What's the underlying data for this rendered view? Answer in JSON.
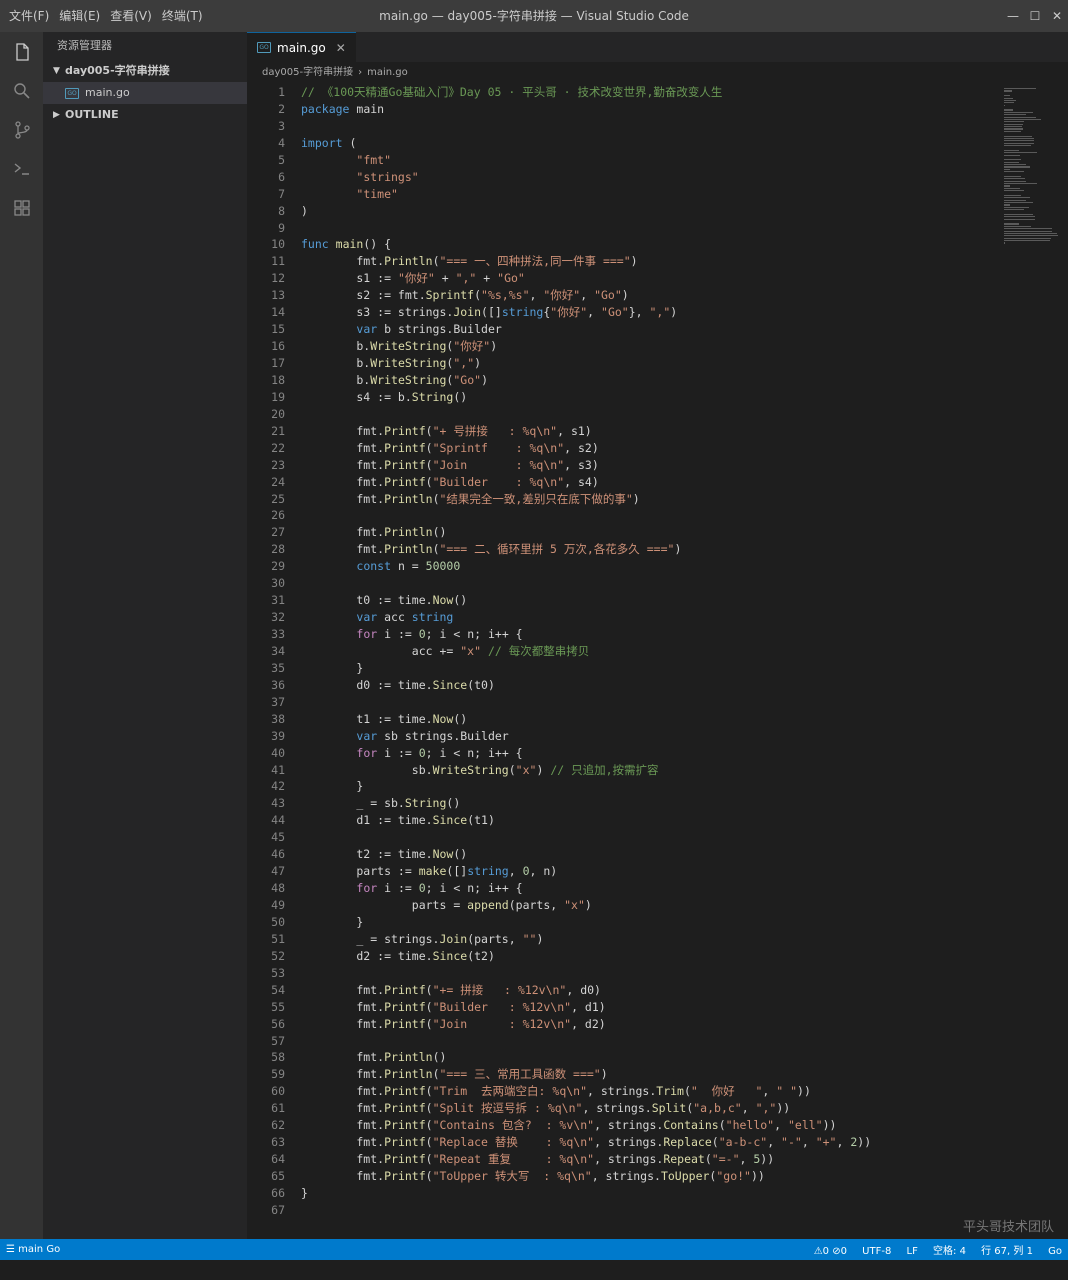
{
  "menu": [
    "文件(F)",
    "编辑(E)",
    "查看(V)",
    "终端(T)"
  ],
  "window_title": "main.go — day005-字符串拼接 — Visual Studio Code",
  "window_controls": {
    "minimize": "—",
    "maximize": "☐",
    "close": "✕"
  },
  "activity_icons": [
    "files-icon",
    "search-icon",
    "source-control-icon",
    "terminal-icon",
    "extensions-icon"
  ],
  "sidebar": {
    "title": "资源管理器",
    "folder": "day005-字符串拼接",
    "file": "main.go",
    "file_badge": "GO",
    "outline": "OUTLINE"
  },
  "tab": {
    "label": "main.go",
    "badge": "GO",
    "close": "✕"
  },
  "breadcrumb": [
    "day005-字符串拼接",
    "main.go"
  ],
  "code_lines": [
    [
      [
        "cm",
        "// 《100天精通Go基础入门》Day 05 · 平头哥 · 技术改变世界,勤奋改变人生"
      ]
    ],
    [
      [
        "kw",
        "package"
      ],
      [
        "pl",
        " main"
      ]
    ],
    [],
    [
      [
        "kw",
        "import"
      ],
      [
        "pl",
        " ("
      ]
    ],
    [
      [
        "pl",
        "        "
      ],
      [
        "str",
        "\"fmt\""
      ]
    ],
    [
      [
        "pl",
        "        "
      ],
      [
        "str",
        "\"strings\""
      ]
    ],
    [
      [
        "pl",
        "        "
      ],
      [
        "str",
        "\"time\""
      ]
    ],
    [
      [
        "pl",
        ")"
      ]
    ],
    [],
    [
      [
        "kw",
        "func"
      ],
      [
        "pl",
        " "
      ],
      [
        "fn",
        "main"
      ],
      [
        "pl",
        "() {"
      ]
    ],
    [
      [
        "pl",
        "        fmt."
      ],
      [
        "fn",
        "Println"
      ],
      [
        "pl",
        "("
      ],
      [
        "str",
        "\"=== 一、四种拼法,同一件事 ===\""
      ],
      [
        "pl",
        ")"
      ]
    ],
    [
      [
        "pl",
        "        s1 := "
      ],
      [
        "str",
        "\"你好\""
      ],
      [
        "pl",
        " + "
      ],
      [
        "str",
        "\",\""
      ],
      [
        "pl",
        " + "
      ],
      [
        "str",
        "\"Go\""
      ]
    ],
    [
      [
        "pl",
        "        s2 := fmt."
      ],
      [
        "fn",
        "Sprintf"
      ],
      [
        "pl",
        "("
      ],
      [
        "str",
        "\"%s,%s\""
      ],
      [
        "pl",
        ", "
      ],
      [
        "str",
        "\"你好\""
      ],
      [
        "pl",
        ", "
      ],
      [
        "str",
        "\"Go\""
      ],
      [
        "pl",
        ")"
      ]
    ],
    [
      [
        "pl",
        "        s3 := strings."
      ],
      [
        "fn",
        "Join"
      ],
      [
        "pl",
        "([]"
      ],
      [
        "kw",
        "string"
      ],
      [
        "pl",
        "{"
      ],
      [
        "str",
        "\"你好\""
      ],
      [
        "pl",
        ", "
      ],
      [
        "str",
        "\"Go\""
      ],
      [
        "pl",
        "}, "
      ],
      [
        "str",
        "\",\""
      ],
      [
        "pl",
        ")"
      ]
    ],
    [
      [
        "pl",
        "        "
      ],
      [
        "kw",
        "var"
      ],
      [
        "pl",
        " b strings.Builder"
      ]
    ],
    [
      [
        "pl",
        "        b."
      ],
      [
        "fn",
        "WriteString"
      ],
      [
        "pl",
        "("
      ],
      [
        "str",
        "\"你好\""
      ],
      [
        "pl",
        ")"
      ]
    ],
    [
      [
        "pl",
        "        b."
      ],
      [
        "fn",
        "WriteString"
      ],
      [
        "pl",
        "("
      ],
      [
        "str",
        "\",\""
      ],
      [
        "pl",
        ")"
      ]
    ],
    [
      [
        "pl",
        "        b."
      ],
      [
        "fn",
        "WriteString"
      ],
      [
        "pl",
        "("
      ],
      [
        "str",
        "\"Go\""
      ],
      [
        "pl",
        ")"
      ]
    ],
    [
      [
        "pl",
        "        s4 := b."
      ],
      [
        "fn",
        "String"
      ],
      [
        "pl",
        "()"
      ]
    ],
    [],
    [
      [
        "pl",
        "        fmt."
      ],
      [
        "fn",
        "Printf"
      ],
      [
        "pl",
        "("
      ],
      [
        "str",
        "\"+ 号拼接   : %q\\n\""
      ],
      [
        "pl",
        ", s1)"
      ]
    ],
    [
      [
        "pl",
        "        fmt."
      ],
      [
        "fn",
        "Printf"
      ],
      [
        "pl",
        "("
      ],
      [
        "str",
        "\"Sprintf    : %q\\n\""
      ],
      [
        "pl",
        ", s2)"
      ]
    ],
    [
      [
        "pl",
        "        fmt."
      ],
      [
        "fn",
        "Printf"
      ],
      [
        "pl",
        "("
      ],
      [
        "str",
        "\"Join       : %q\\n\""
      ],
      [
        "pl",
        ", s3)"
      ]
    ],
    [
      [
        "pl",
        "        fmt."
      ],
      [
        "fn",
        "Printf"
      ],
      [
        "pl",
        "("
      ],
      [
        "str",
        "\"Builder    : %q\\n\""
      ],
      [
        "pl",
        ", s4)"
      ]
    ],
    [
      [
        "pl",
        "        fmt."
      ],
      [
        "fn",
        "Println"
      ],
      [
        "pl",
        "("
      ],
      [
        "str",
        "\"结果完全一致,差别只在底下做的事\""
      ],
      [
        "pl",
        ")"
      ]
    ],
    [],
    [
      [
        "pl",
        "        fmt."
      ],
      [
        "fn",
        "Println"
      ],
      [
        "pl",
        "()"
      ]
    ],
    [
      [
        "pl",
        "        fmt."
      ],
      [
        "fn",
        "Println"
      ],
      [
        "pl",
        "("
      ],
      [
        "str",
        "\"=== 二、循环里拼 5 万次,各花多久 ===\""
      ],
      [
        "pl",
        ")"
      ]
    ],
    [
      [
        "pl",
        "        "
      ],
      [
        "kw",
        "const"
      ],
      [
        "pl",
        " n = "
      ],
      [
        "num",
        "50000"
      ]
    ],
    [],
    [
      [
        "pl",
        "        t0 := time."
      ],
      [
        "fn",
        "Now"
      ],
      [
        "pl",
        "()"
      ]
    ],
    [
      [
        "pl",
        "        "
      ],
      [
        "kw",
        "var"
      ],
      [
        "pl",
        " acc "
      ],
      [
        "kw",
        "string"
      ]
    ],
    [
      [
        "pl",
        "        "
      ],
      [
        "ctl",
        "for"
      ],
      [
        "pl",
        " i := "
      ],
      [
        "num",
        "0"
      ],
      [
        "pl",
        "; i < n; i++ {"
      ]
    ],
    [
      [
        "pl",
        "                acc += "
      ],
      [
        "str",
        "\"x\""
      ],
      [
        "pl",
        " "
      ],
      [
        "cm",
        "// 每次都整串拷贝"
      ]
    ],
    [
      [
        "pl",
        "        }"
      ]
    ],
    [
      [
        "pl",
        "        d0 := time."
      ],
      [
        "fn",
        "Since"
      ],
      [
        "pl",
        "(t0)"
      ]
    ],
    [],
    [
      [
        "pl",
        "        t1 := time."
      ],
      [
        "fn",
        "Now"
      ],
      [
        "pl",
        "()"
      ]
    ],
    [
      [
        "pl",
        "        "
      ],
      [
        "kw",
        "var"
      ],
      [
        "pl",
        " sb strings.Builder"
      ]
    ],
    [
      [
        "pl",
        "        "
      ],
      [
        "ctl",
        "for"
      ],
      [
        "pl",
        " i := "
      ],
      [
        "num",
        "0"
      ],
      [
        "pl",
        "; i < n; i++ {"
      ]
    ],
    [
      [
        "pl",
        "                sb."
      ],
      [
        "fn",
        "WriteString"
      ],
      [
        "pl",
        "("
      ],
      [
        "str",
        "\"x\""
      ],
      [
        "pl",
        ") "
      ],
      [
        "cm",
        "// 只追加,按需扩容"
      ]
    ],
    [
      [
        "pl",
        "        }"
      ]
    ],
    [
      [
        "pl",
        "        _ = sb."
      ],
      [
        "fn",
        "String"
      ],
      [
        "pl",
        "()"
      ]
    ],
    [
      [
        "pl",
        "        d1 := time."
      ],
      [
        "fn",
        "Since"
      ],
      [
        "pl",
        "(t1)"
      ]
    ],
    [],
    [
      [
        "pl",
        "        t2 := time."
      ],
      [
        "fn",
        "Now"
      ],
      [
        "pl",
        "()"
      ]
    ],
    [
      [
        "pl",
        "        parts := "
      ],
      [
        "fn",
        "make"
      ],
      [
        "pl",
        "([]"
      ],
      [
        "kw",
        "string"
      ],
      [
        "pl",
        ", "
      ],
      [
        "num",
        "0"
      ],
      [
        "pl",
        ", n)"
      ]
    ],
    [
      [
        "pl",
        "        "
      ],
      [
        "ctl",
        "for"
      ],
      [
        "pl",
        " i := "
      ],
      [
        "num",
        "0"
      ],
      [
        "pl",
        "; i < n; i++ {"
      ]
    ],
    [
      [
        "pl",
        "                parts = "
      ],
      [
        "fn",
        "append"
      ],
      [
        "pl",
        "(parts, "
      ],
      [
        "str",
        "\"x\""
      ],
      [
        "pl",
        ")"
      ]
    ],
    [
      [
        "pl",
        "        }"
      ]
    ],
    [
      [
        "pl",
        "        _ = strings."
      ],
      [
        "fn",
        "Join"
      ],
      [
        "pl",
        "(parts, "
      ],
      [
        "str",
        "\"\""
      ],
      [
        "pl",
        ")"
      ]
    ],
    [
      [
        "pl",
        "        d2 := time."
      ],
      [
        "fn",
        "Since"
      ],
      [
        "pl",
        "(t2)"
      ]
    ],
    [],
    [
      [
        "pl",
        "        fmt."
      ],
      [
        "fn",
        "Printf"
      ],
      [
        "pl",
        "("
      ],
      [
        "str",
        "\"+= 拼接   : %12v\\n\""
      ],
      [
        "pl",
        ", d0)"
      ]
    ],
    [
      [
        "pl",
        "        fmt."
      ],
      [
        "fn",
        "Printf"
      ],
      [
        "pl",
        "("
      ],
      [
        "str",
        "\"Builder   : %12v\\n\""
      ],
      [
        "pl",
        ", d1)"
      ]
    ],
    [
      [
        "pl",
        "        fmt."
      ],
      [
        "fn",
        "Printf"
      ],
      [
        "pl",
        "("
      ],
      [
        "str",
        "\"Join      : %12v\\n\""
      ],
      [
        "pl",
        ", d2)"
      ]
    ],
    [],
    [
      [
        "pl",
        "        fmt."
      ],
      [
        "fn",
        "Println"
      ],
      [
        "pl",
        "()"
      ]
    ],
    [
      [
        "pl",
        "        fmt."
      ],
      [
        "fn",
        "Println"
      ],
      [
        "pl",
        "("
      ],
      [
        "str",
        "\"=== 三、常用工具函数 ===\""
      ],
      [
        "pl",
        ")"
      ]
    ],
    [
      [
        "pl",
        "        fmt."
      ],
      [
        "fn",
        "Printf"
      ],
      [
        "pl",
        "("
      ],
      [
        "str",
        "\"Trim  去两端空白: %q\\n\""
      ],
      [
        "pl",
        ", strings."
      ],
      [
        "fn",
        "Trim"
      ],
      [
        "pl",
        "("
      ],
      [
        "str",
        "\"  你好   \""
      ],
      [
        "pl",
        ", "
      ],
      [
        "str",
        "\" \""
      ],
      [
        "pl",
        "))"
      ]
    ],
    [
      [
        "pl",
        "        fmt."
      ],
      [
        "fn",
        "Printf"
      ],
      [
        "pl",
        "("
      ],
      [
        "str",
        "\"Split 按逗号拆 : %q\\n\""
      ],
      [
        "pl",
        ", strings."
      ],
      [
        "fn",
        "Split"
      ],
      [
        "pl",
        "("
      ],
      [
        "str",
        "\"a,b,c\""
      ],
      [
        "pl",
        ", "
      ],
      [
        "str",
        "\",\""
      ],
      [
        "pl",
        "))"
      ]
    ],
    [
      [
        "pl",
        "        fmt."
      ],
      [
        "fn",
        "Printf"
      ],
      [
        "pl",
        "("
      ],
      [
        "str",
        "\"Contains 包含?  : %v\\n\""
      ],
      [
        "pl",
        ", strings."
      ],
      [
        "fn",
        "Contains"
      ],
      [
        "pl",
        "("
      ],
      [
        "str",
        "\"hello\""
      ],
      [
        "pl",
        ", "
      ],
      [
        "str",
        "\"ell\""
      ],
      [
        "pl",
        "))"
      ]
    ],
    [
      [
        "pl",
        "        fmt."
      ],
      [
        "fn",
        "Printf"
      ],
      [
        "pl",
        "("
      ],
      [
        "str",
        "\"Replace 替换    : %q\\n\""
      ],
      [
        "pl",
        ", strings."
      ],
      [
        "fn",
        "Replace"
      ],
      [
        "pl",
        "("
      ],
      [
        "str",
        "\"a-b-c\""
      ],
      [
        "pl",
        ", "
      ],
      [
        "str",
        "\"-\""
      ],
      [
        "pl",
        ", "
      ],
      [
        "str",
        "\"+\""
      ],
      [
        "pl",
        ", "
      ],
      [
        "num",
        "2"
      ],
      [
        "pl",
        "))"
      ]
    ],
    [
      [
        "pl",
        "        fmt."
      ],
      [
        "fn",
        "Printf"
      ],
      [
        "pl",
        "("
      ],
      [
        "str",
        "\"Repeat 重复     : %q\\n\""
      ],
      [
        "pl",
        ", strings."
      ],
      [
        "fn",
        "Repeat"
      ],
      [
        "pl",
        "("
      ],
      [
        "str",
        "\"=-\""
      ],
      [
        "pl",
        ", "
      ],
      [
        "num",
        "5"
      ],
      [
        "pl",
        "))"
      ]
    ],
    [
      [
        "pl",
        "        fmt."
      ],
      [
        "fn",
        "Printf"
      ],
      [
        "pl",
        "("
      ],
      [
        "str",
        "\"ToUpper 转大写  : %q\\n\""
      ],
      [
        "pl",
        ", strings."
      ],
      [
        "fn",
        "ToUpper"
      ],
      [
        "pl",
        "("
      ],
      [
        "str",
        "\"go!\""
      ],
      [
        "pl",
        "))"
      ]
    ],
    [
      [
        "pl",
        "}"
      ]
    ],
    []
  ],
  "watermark": "平头哥技术团队",
  "status": {
    "branch": "main",
    "branch_icon": "☰",
    "language_left": "Go",
    "problems": "⚠0 ⊘0",
    "encoding": "UTF-8",
    "eol": "LF",
    "indent": "空格: 4",
    "position": "行 67, 列 1",
    "language": "Go"
  },
  "colors": {
    "statusbar": "#007acc",
    "keyword": "#569cd6",
    "string": "#ce9178",
    "comment": "#6a9955"
  }
}
